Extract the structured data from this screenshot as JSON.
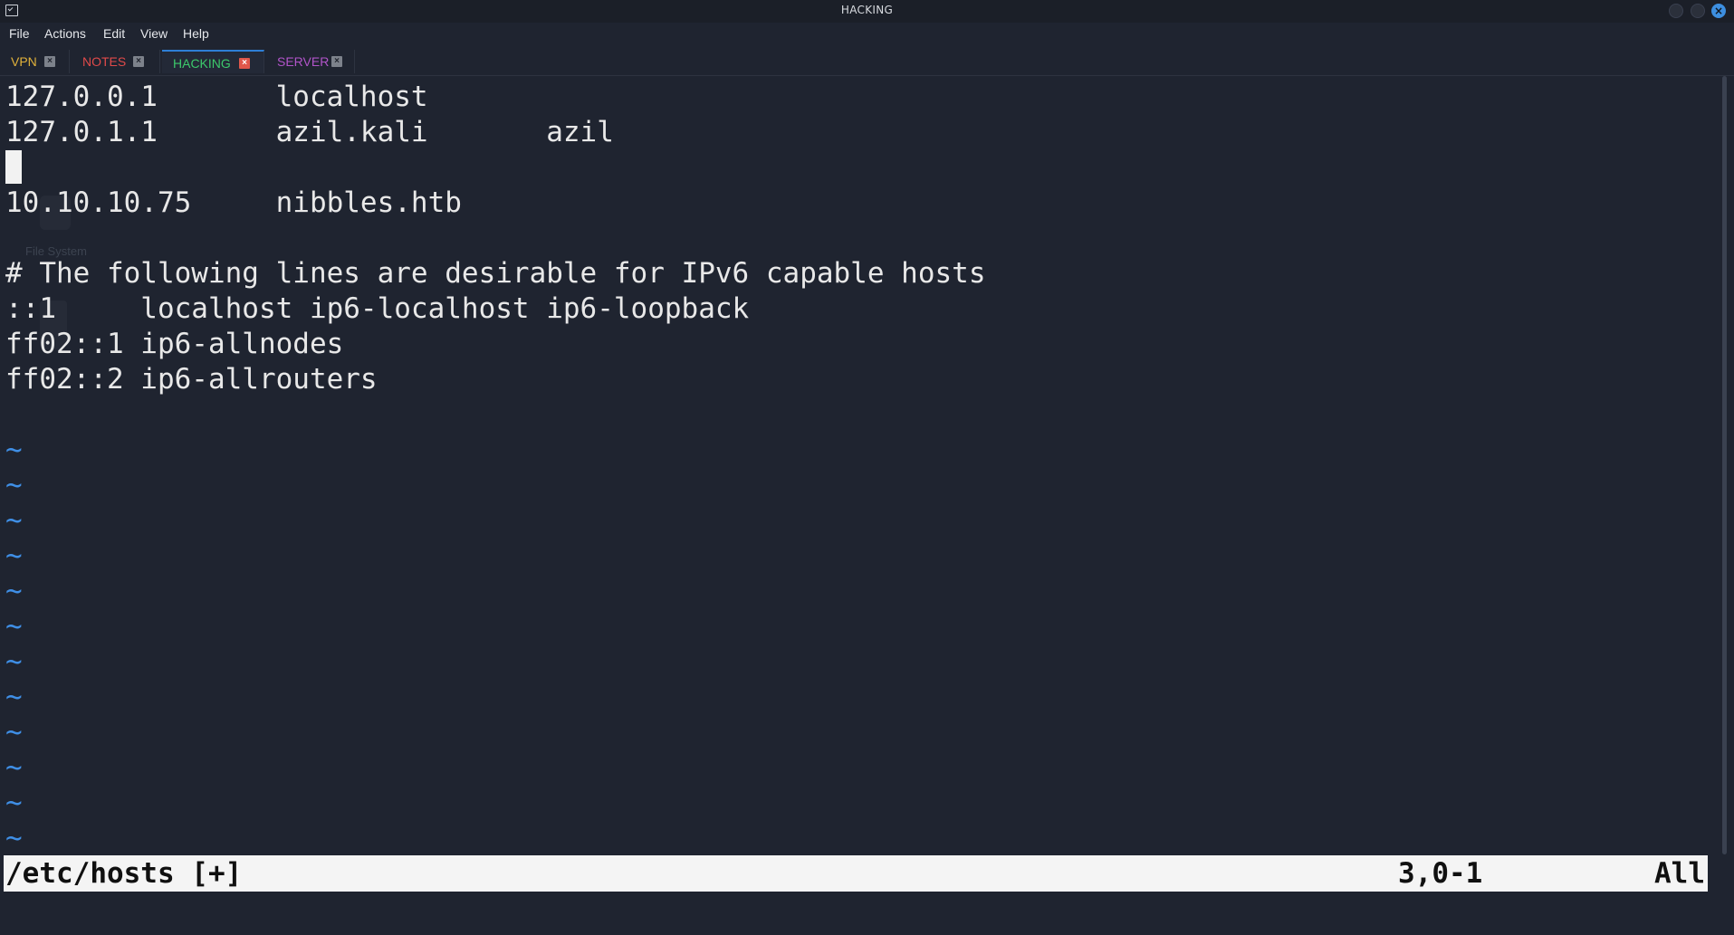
{
  "window": {
    "title": "HACKING"
  },
  "menu": [
    {
      "label": "File"
    },
    {
      "label": "Actions"
    },
    {
      "label": "Edit"
    },
    {
      "label": "View"
    },
    {
      "label": "Help"
    }
  ],
  "tabs": [
    {
      "label": "VPN",
      "color": "#e0b13a",
      "active": false
    },
    {
      "label": "NOTES",
      "color": "#e04a4a",
      "active": false
    },
    {
      "label": "HACKING",
      "color": "#3cc96b",
      "active": true
    },
    {
      "label": "SERVER",
      "color": "#b154c9",
      "active": false
    }
  ],
  "editor": {
    "lines": [
      "127.0.0.1       localhost",
      "127.0.1.1       azil.kali       azil",
      "",
      "10.10.10.75     nibbles.htb",
      "",
      "# The following lines are desirable for IPv6 capable hosts",
      "::1     localhost ip6-localhost ip6-loopback",
      "ff02::1 ip6-allnodes",
      "ff02::2 ip6-allrouters",
      ""
    ],
    "tilde": "~",
    "tilde_count": 12
  },
  "desktop_ghost": {
    "label": "File System"
  },
  "statusline": {
    "filename": "/etc/hosts [+]",
    "position": "3,0-1",
    "scroll": "All"
  },
  "colors": {
    "background": "#1f2430",
    "text": "#e8e8e8",
    "tilde": "#3f8fe6",
    "accent": "#2e7fd6"
  }
}
